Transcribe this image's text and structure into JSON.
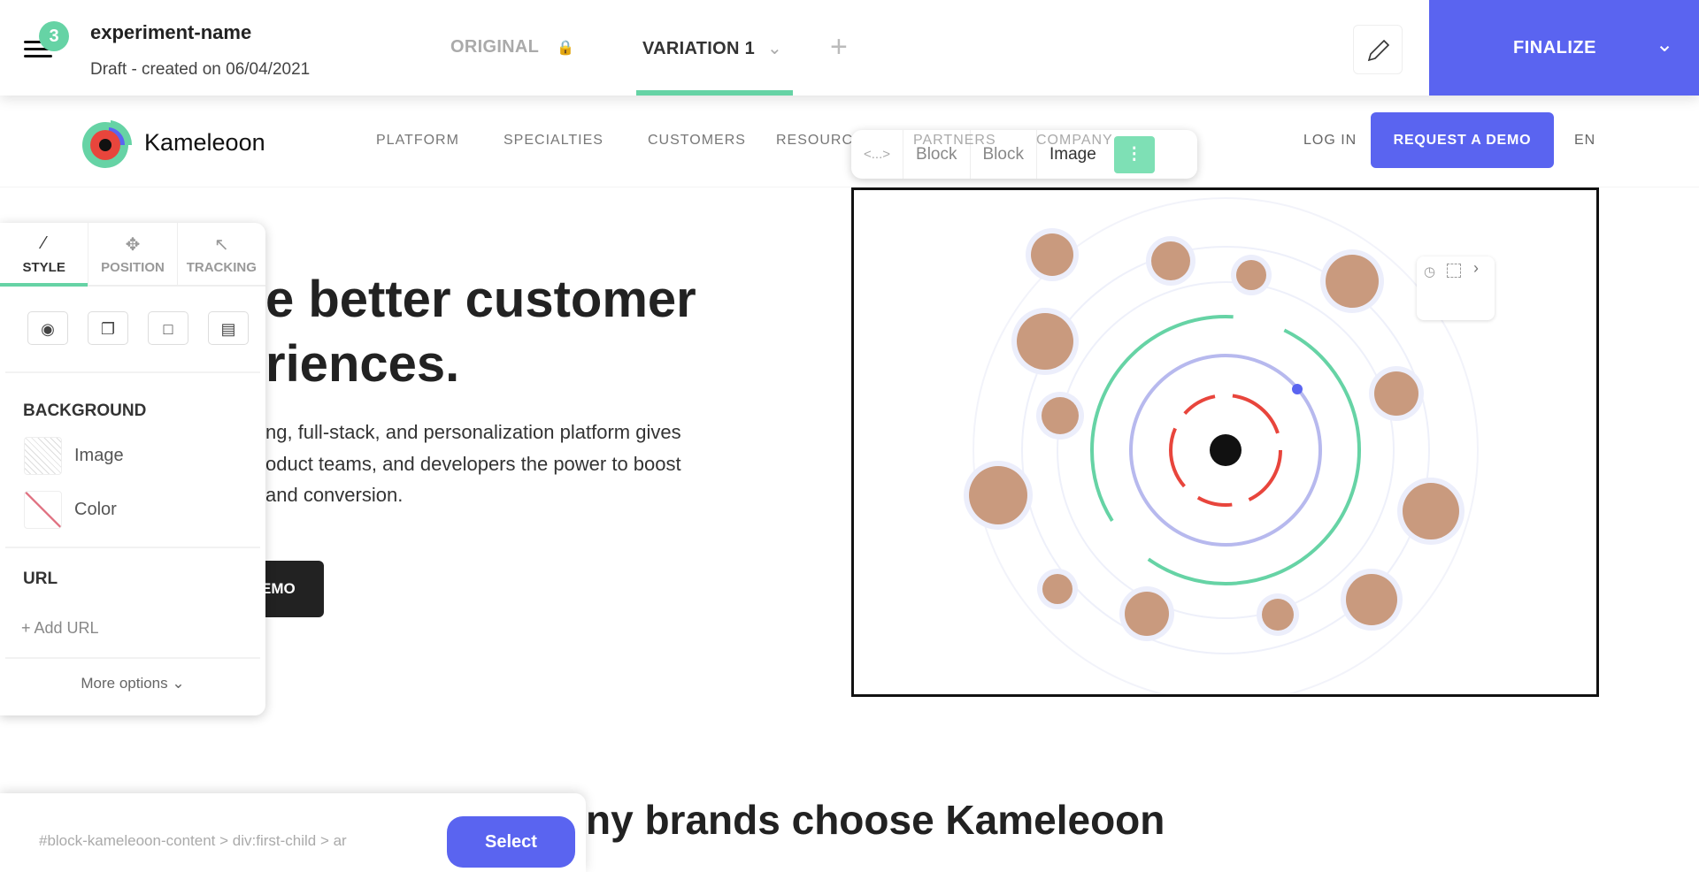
{
  "topbar": {
    "notification_count": "3",
    "experiment_name": "experiment-name",
    "status": "Draft - created on 06/04/2021",
    "tabs": [
      {
        "label": "ORIGINAL",
        "locked": true
      },
      {
        "label": "VARIATION 1",
        "active": true
      }
    ],
    "add_tab_icon": "plus-icon",
    "edit_icon": "pencil-icon",
    "finalize_label": "FINALIZE"
  },
  "site": {
    "brand": "Kameleoon",
    "nav": [
      "PLATFORM",
      "SPECIALTIES",
      "CUSTOMERS",
      "RESOURCES",
      "PARTNERS",
      "COMPANY"
    ],
    "login": "LOG IN",
    "request_demo": "REQUEST A DEMO",
    "language": "EN",
    "headline": [
      "e better customer",
      "riences."
    ],
    "paragraph": [
      "ng, full-stack, and personalization platform gives",
      "oduct teams, and developers the power to boost",
      "and conversion."
    ],
    "cta_partial": "EMO",
    "section_title": "ny brands choose Kameleoon"
  },
  "breadcrumb": {
    "code_icon": "<...>",
    "items": [
      "Block",
      "Block",
      "Image"
    ]
  },
  "panel": {
    "tabs": [
      {
        "label": "STYLE",
        "icon": "brush-icon"
      },
      {
        "label": "POSITION",
        "icon": "move-icon"
      },
      {
        "label": "TRACKING",
        "icon": "cursor-icon"
      }
    ],
    "tools": [
      "eye-icon",
      "copy-icon",
      "select-parent-icon",
      "select-child-icon"
    ],
    "background_heading": "BACKGROUND",
    "background_image": "Image",
    "background_color": "Color",
    "url_heading": "URL",
    "add_url": "Add URL",
    "more_options": "More options"
  },
  "selector_bar": {
    "selector": "#block-kameleoon-content > div:first-child > ar",
    "select_label": "Select"
  },
  "colors": {
    "accent": "#5a64f0",
    "green": "#66d3a5",
    "red": "#e8453c"
  }
}
